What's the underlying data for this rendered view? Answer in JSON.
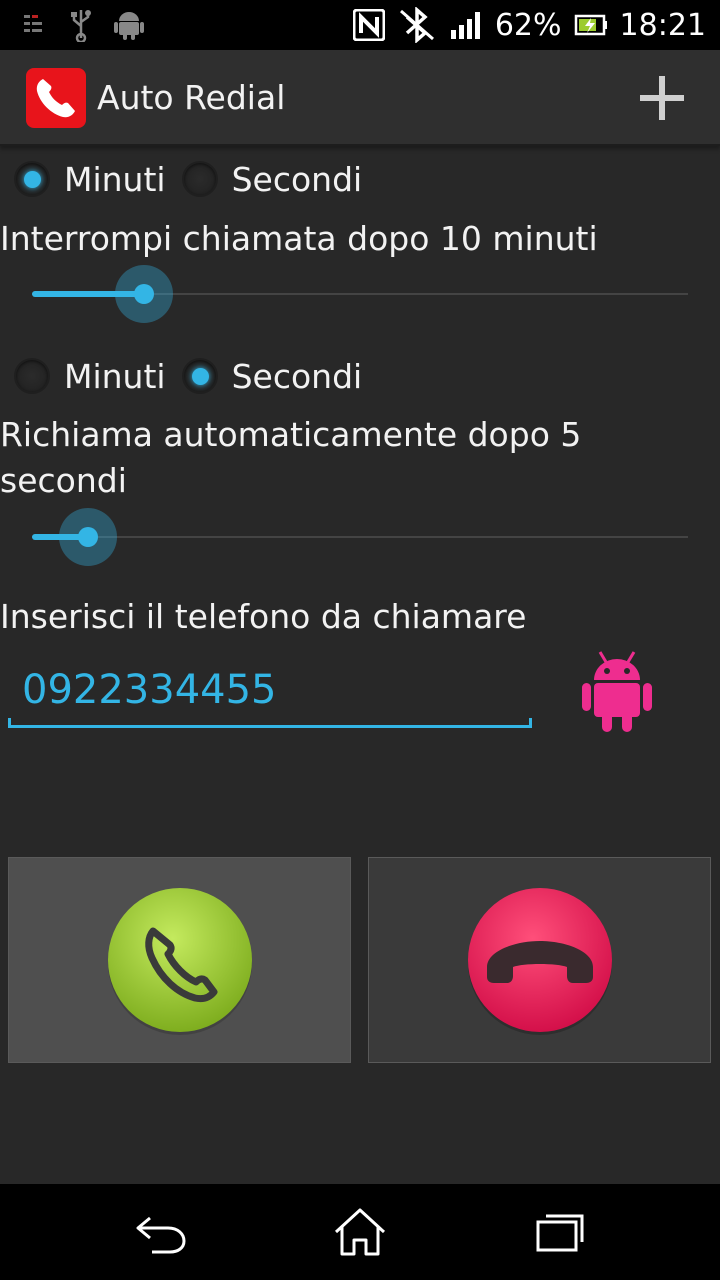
{
  "status_bar": {
    "battery_percent": "62%",
    "time": "18:21",
    "left_icons": [
      "notification-icon",
      "usb-icon",
      "android-debug-icon"
    ],
    "right_icons": [
      "nfc-icon",
      "bluetooth-icon",
      "signal-icon",
      "battery-icon"
    ]
  },
  "app": {
    "title": "Auto Redial",
    "icon": "phone-icon",
    "add_icon": "plus-icon"
  },
  "hangup_section": {
    "unit_options": [
      "Minuti",
      "Secondi"
    ],
    "selected_unit": "Minuti",
    "label": "Interrompi chiamata dopo 10 minuti",
    "slider_fraction": 0.17
  },
  "redial_section": {
    "unit_options": [
      "Minuti",
      "Secondi"
    ],
    "selected_unit": "Secondi",
    "label": "Richiama automaticamente dopo 5 secondi",
    "slider_fraction": 0.085
  },
  "phone": {
    "label": "Inserisci il telefono da chiamare",
    "value": "0922334455",
    "contact_icon": "android-icon"
  },
  "buttons": {
    "call_icon": "call-icon",
    "hangup_icon": "hangup-icon"
  },
  "colors": {
    "accent": "#33b5e5",
    "call_green": "#9ccc2f",
    "hangup_pink": "#e8275a",
    "contact_pink": "#ee2d8f",
    "app_red": "#e8141b"
  },
  "nav": {
    "icons": [
      "back-icon",
      "home-icon",
      "recents-icon"
    ]
  }
}
